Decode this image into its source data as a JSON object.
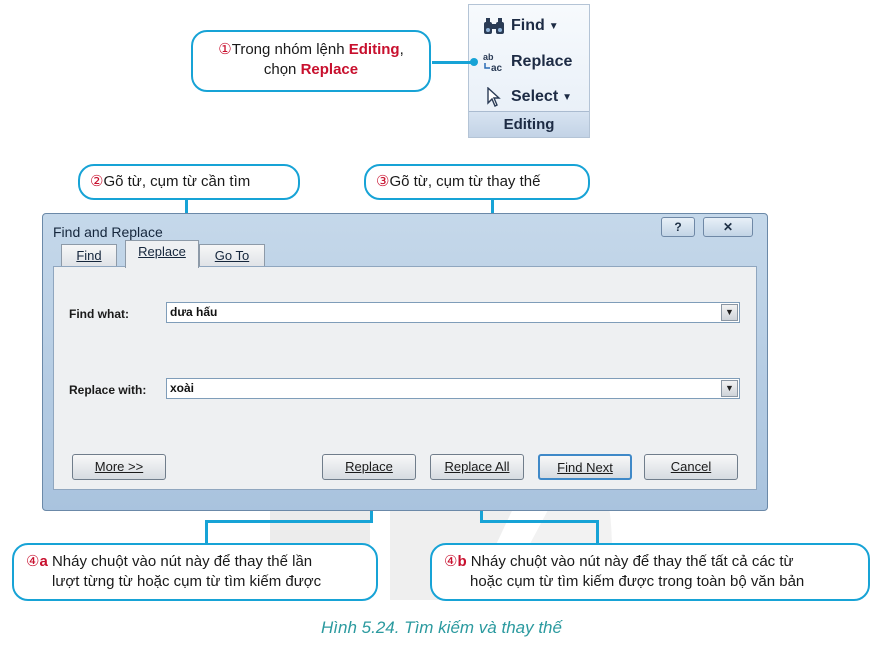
{
  "ribbon": {
    "find_label": "Find",
    "replace_label": "Replace",
    "select_label": "Select",
    "group_label": "Editing",
    "replace_icon_text": "ab→ac"
  },
  "callouts": {
    "c1": {
      "num": "①",
      "line1_pre": "Trong nhóm lệnh ",
      "line1_em": "Editing",
      "line1_post": ",",
      "line2_pre": "chọn ",
      "line2_em": "Replace"
    },
    "c2": {
      "num": "②",
      "text": "Gõ từ, cụm từ cần tìm"
    },
    "c3": {
      "num": "③",
      "text": "Gõ từ, cụm từ thay thế"
    },
    "c4a": {
      "num": "④",
      "sub": "a",
      "line1": "Nháy chuột vào nút này để thay thế lần",
      "line2": "lượt từng từ hoặc cụm từ tìm kiếm được"
    },
    "c4b": {
      "num": "④",
      "sub": "b",
      "line1": "Nháy chuột vào nút này để thay thế tất cả các từ",
      "line2": "hoặc cụm từ tìm kiếm được trong toàn bộ văn bản"
    }
  },
  "dialog": {
    "title": "Find and Replace",
    "help_label": "?",
    "close_label": "✕",
    "tabs": [
      "Find",
      "Replace",
      "Go To"
    ],
    "find_label": "Find what:",
    "find_value": "dưa hấu",
    "replace_label": "Replace with:",
    "replace_value": "xoài",
    "buttons": {
      "more": "More >>",
      "replace": "Replace",
      "replace_all": "Replace All",
      "find_next": "Find Next",
      "cancel": "Cancel"
    }
  },
  "caption": "Hình 5.24. Tìm kiếm và thay thế",
  "colors": {
    "callout_border": "#17a3d6",
    "accent_red": "#c8102e",
    "caption": "#2b9a9f"
  },
  "icons": [
    "binoculars-icon",
    "replace-icon",
    "cursor-arrow-icon",
    "dropdown-arrow-icon",
    "help-icon",
    "close-icon"
  ]
}
